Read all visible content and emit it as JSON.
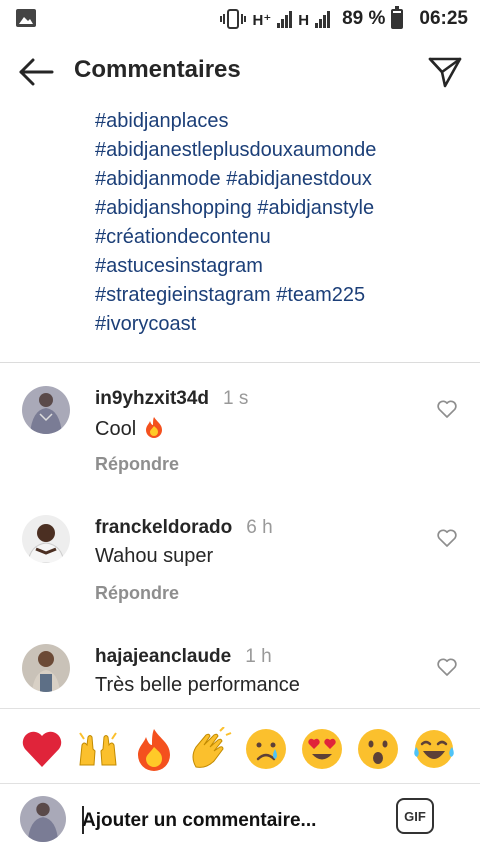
{
  "status_bar": {
    "network_1": "H⁺",
    "network_2": "H",
    "battery_percent": "89 %",
    "battery_level": 0.89,
    "time": "06:25"
  },
  "header": {
    "title": "Commentaires",
    "back_icon": "arrow-left-icon",
    "send_icon": "paper-plane-icon"
  },
  "caption": {
    "lines": [
      "#abidjanplaces",
      "#abidjanestleplusdouxaumonde",
      "#abidjanmode #abidjanestdoux",
      "#abidjanshopping #abidjanstyle",
      "#créationdecontenu",
      "#astucesinstagram",
      "#strategieinstagram #team225",
      "#ivorycoast"
    ],
    "color": "#1c3f78"
  },
  "comments": [
    {
      "username": "in9yhzxit34d",
      "time": "1 s",
      "text": "Cool",
      "emoji": "🔥",
      "reply_label": "Répondre"
    },
    {
      "username": "franckeldorado",
      "time": "6 h",
      "text": "Wahou super",
      "reply_label": "Répondre"
    },
    {
      "username": "hajajeanclaude",
      "time": "1 h",
      "text": "Très belle performance"
    }
  ],
  "emoji_bar": [
    "heart",
    "raising-hands",
    "fire",
    "clapping-hands",
    "crying-face",
    "heart-eyes",
    "surprised-face",
    "tears-of-joy"
  ],
  "input": {
    "placeholder": "Ajouter un commentaire...",
    "gif_label": "GIF"
  }
}
